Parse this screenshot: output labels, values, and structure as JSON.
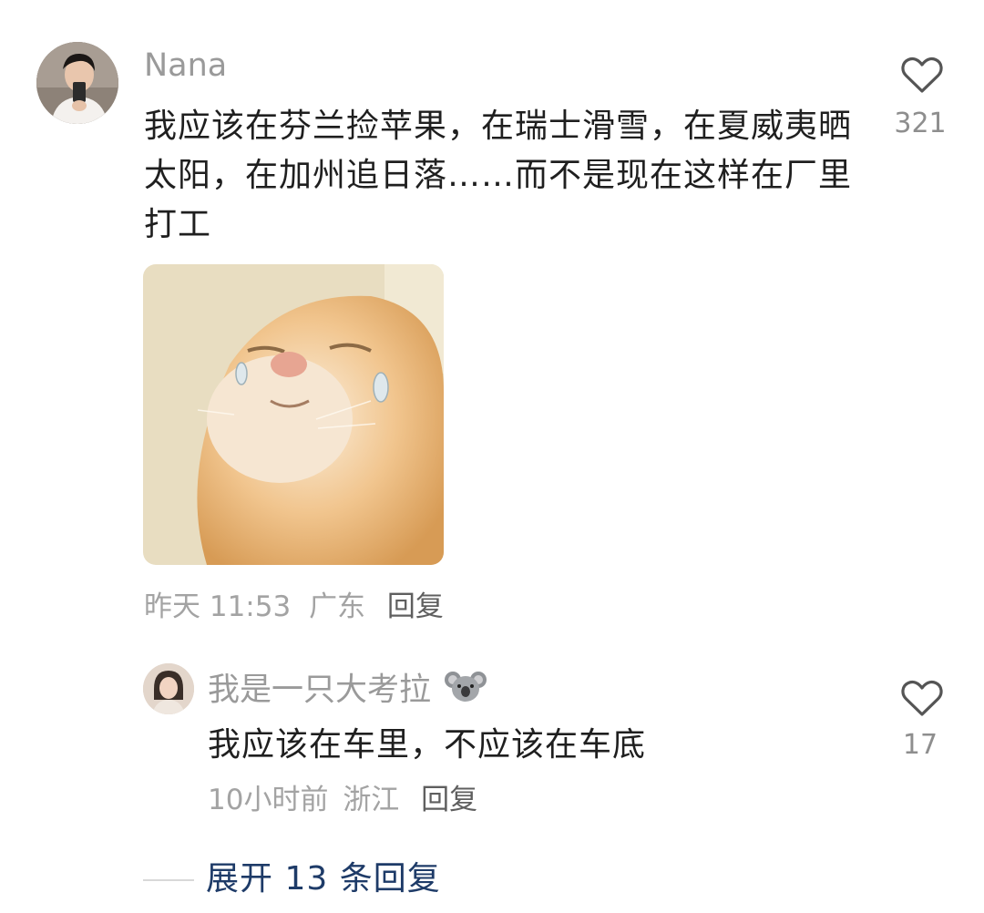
{
  "comment": {
    "username": "Nana",
    "text": "我应该在芬兰捡苹果，在瑞士滑雪，在夏威夷晒太阳，在加州追日落……而不是现在这样在厂里打工",
    "like_count": "321",
    "sticker_icon": "crying-cat-sticker",
    "meta": {
      "time": "昨天 11:53",
      "location": "广东",
      "reply_label": "回复"
    }
  },
  "reply": {
    "username": "我是一只大考拉",
    "username_emoji": "koala-emoji",
    "text": "我应该在车里，不应该在车底",
    "like_count": "17",
    "meta": {
      "time": "10小时前",
      "location": "浙江",
      "reply_label": "回复"
    }
  },
  "expand": {
    "label": "展开 13 条回复"
  },
  "colors": {
    "expand_link": "#1e3b68",
    "meta_text": "#a3a3a3",
    "username": "#9a9a9a"
  }
}
